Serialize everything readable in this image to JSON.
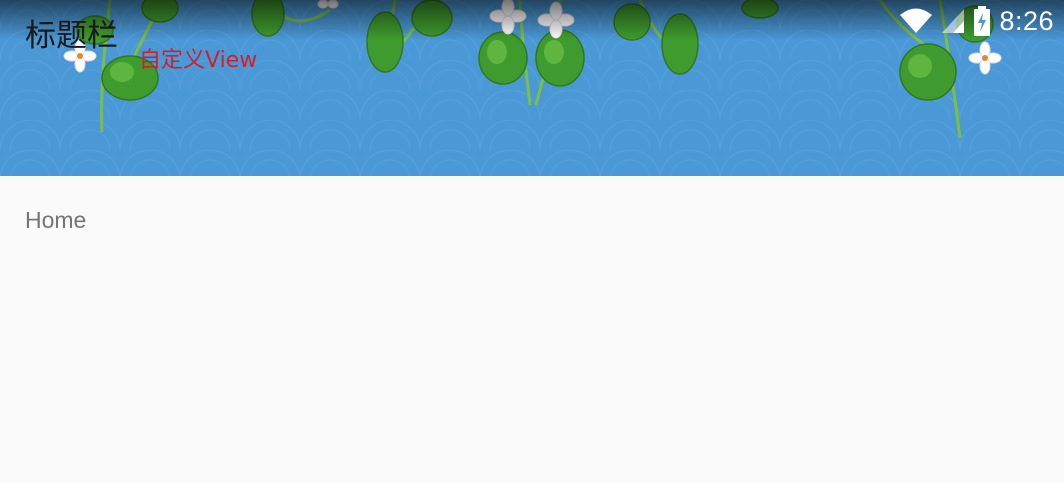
{
  "toolbar": {
    "title": "标题栏",
    "custom_view_label": "自定义View"
  },
  "status_bar": {
    "time": "8:26",
    "icons": [
      "wifi-icon",
      "cell-signal-icon",
      "battery-charging-icon"
    ]
  },
  "content": {
    "text": "Home"
  },
  "colors": {
    "header_background": "#4a98d6",
    "title_text": "#1a1a1a",
    "custom_view_text": "#d21f2a",
    "content_background": "#fafafa",
    "content_text": "#757575"
  },
  "header_decoration": "hanging-vines-with-white-flowers"
}
